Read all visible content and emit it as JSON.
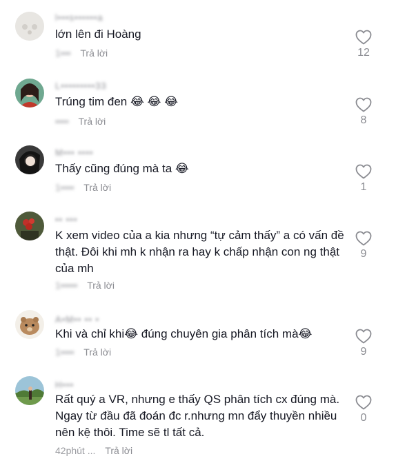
{
  "comments": [
    {
      "username": "l•••s••••••a",
      "text": "lớn lên đi Hoàng",
      "time": "1•••",
      "reply": "Trả lời",
      "likes": "12"
    },
    {
      "username": "L•••••••••33",
      "text": "Trúng tim đen 😂 😂 😂",
      "time": "••••",
      "reply": "Trả lời",
      "likes": "8"
    },
    {
      "username": "M••• ••••",
      "text": "Thấy cũng đúng mà ta 😂",
      "time": "1••••",
      "reply": "Trả lời",
      "likes": "1"
    },
    {
      "username": "•• •••",
      "text": "K xem video của a kia nhưng “tự cảm thấy” a có vấn đề thật. Đôi khi mh k nhận ra hay k chấp nhận con ng thật của mh",
      "time": "1•••••",
      "reply": "Trả lời",
      "likes": "9"
    },
    {
      "username": "A•M•• •• •",
      "text": "Khi và chỉ khi😂 đúng chuyên gia phân tích mà😂",
      "time": "1••••",
      "reply": "Trả lời",
      "likes": "9"
    },
    {
      "username": "H•••",
      "text": "Rất quý a VR, nhưng e thấy QS phân tích cx đúng mà. Ngay từ đầu đã đoán đc r.nhưng mn đẩy thuyền nhiều nên kệ thôi. Time sẽ tl tất cả.",
      "time": "42phút ...",
      "reply": "Trả lời",
      "likes": "0"
    }
  ],
  "icons": {
    "like": "heart-outline-icon"
  },
  "colors": {
    "text": "#161823",
    "muted": "#8a8b91"
  }
}
